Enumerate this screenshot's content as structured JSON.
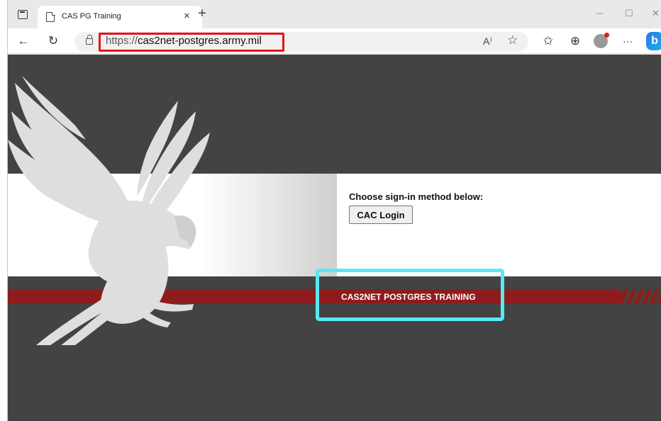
{
  "browser": {
    "tab": {
      "title": "CAS PG Training",
      "close_glyph": "×"
    },
    "new_tab_glyph": "+",
    "window_controls": {
      "minimize": "─",
      "maximize": "☐",
      "close": "✕"
    },
    "nav": {
      "back_glyph": "←",
      "refresh_glyph": "↻"
    },
    "address": {
      "scheme": "https://",
      "host": "cas2net-postgres.army.mil"
    },
    "toolbar_icons": [
      "read-aloud-icon",
      "favorite-star-icon",
      "favorites-list-icon",
      "collections-icon",
      "profile-icon",
      "more-icon",
      "copilot-icon"
    ],
    "read_aloud_glyph": "A⁾",
    "star_glyph": "☆",
    "favorites_glyph": "✩",
    "collections_glyph": "⊕",
    "more_glyph": "···",
    "copilot_glyph": "b"
  },
  "page": {
    "signin_prompt": "Choose sign-in method below:",
    "cac_button": "CAC Login",
    "banner_text": "CAS2NET POSTGRES TRAINING"
  },
  "annotations": {
    "url_box_color": "#e4141b",
    "training_box_color": "#5ce8f2"
  },
  "colors": {
    "page_bg": "#434343",
    "red_band": "#8f1c1c",
    "white_band": "#ffffff"
  }
}
